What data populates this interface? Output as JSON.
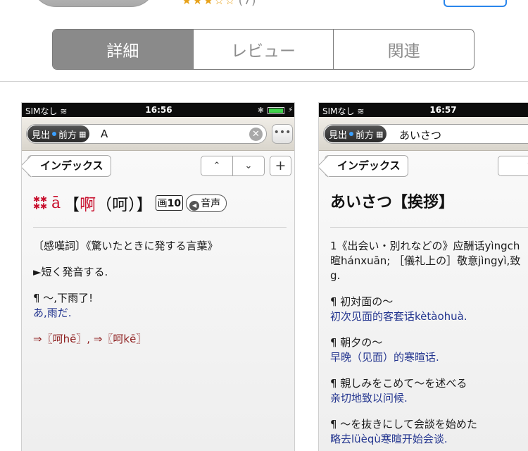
{
  "header": {
    "rating_stars": "★★★☆☆",
    "rating_count": "(7)"
  },
  "tabs": [
    {
      "label": "詳細",
      "active": true
    },
    {
      "label": "レビュー",
      "active": false
    },
    {
      "label": "関連",
      "active": false
    }
  ],
  "screenshot1": {
    "status": {
      "carrier": "SIMなし",
      "time": "16:56"
    },
    "search": {
      "scope_label": "見出",
      "scope_mode": "前方",
      "query": "A"
    },
    "nav": {
      "back_label": "インデックス",
      "up": "⌃",
      "down": "⌄",
      "plus": "+"
    },
    "entry": {
      "freq_mark": "**\n**",
      "pinyin": "ā",
      "bracket_open": "【",
      "headword": "啊",
      "variant": "（呵）",
      "bracket_close": "】",
      "strokes_label": "画",
      "strokes": "10",
      "audio_label": "音声",
      "lines": [
        "〔感嘆詞〕《驚いたときに発する言葉》",
        "►短く発音する.",
        "¶ 〜,下雨了!",
        "あ,雨だ.",
        "⇒〖呵hē〗, ⇒〖呵kē〗"
      ]
    }
  },
  "screenshot2": {
    "status": {
      "carrier": "SIMなし",
      "time": "16:57"
    },
    "search": {
      "scope_label": "見出",
      "scope_mode": "前方",
      "query": "あいさつ"
    },
    "nav": {
      "back_label": "インデックス",
      "up": "⌃"
    },
    "entry": {
      "title": "あいさつ【挨拶】",
      "lines": [
        "1《出会い・別れなどの》应酬话yìngch",
        "暄hánxuān; ［儀礼上の］敬意jìngyì,致",
        "g.",
        "¶ 初対面の〜",
        "初次见面的客套话kètàohuà.",
        "¶ 朝夕の〜",
        "早晚（见面）的寒暄话.",
        "¶ 親しみをこめて〜を述べる",
        "亲切地致以问候.",
        "¶ 〜を抜きにして会談を始めた",
        "略去lüèqù寒暄开始会谈."
      ]
    }
  },
  "colors": {
    "accent_red": "#c8102e",
    "example_blue": "#23358f",
    "segment_active": "#8a8a8a",
    "star": "#e7a21a"
  }
}
